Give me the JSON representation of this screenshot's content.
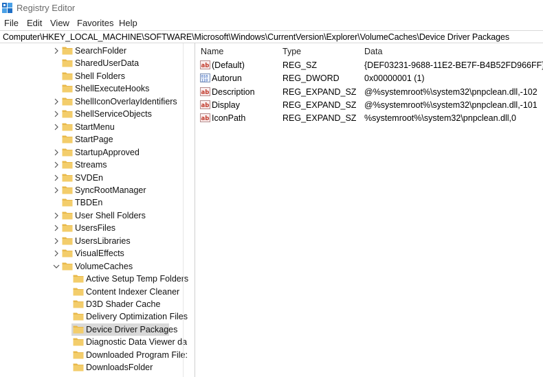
{
  "window": {
    "title": "Registry Editor"
  },
  "menu": [
    "File",
    "Edit",
    "View",
    "Favorites",
    "Help"
  ],
  "address": "Computer\\HKEY_LOCAL_MACHINE\\SOFTWARE\\Microsoft\\Windows\\CurrentVersion\\Explorer\\VolumeCaches\\Device Driver Packages",
  "tree": [
    {
      "label": "SearchFolder",
      "expandable": true,
      "level": 1
    },
    {
      "label": "SharedUserData",
      "expandable": false,
      "level": 1
    },
    {
      "label": "Shell Folders",
      "expandable": false,
      "level": 1
    },
    {
      "label": "ShellExecuteHooks",
      "expandable": false,
      "level": 1
    },
    {
      "label": "ShellIconOverlayIdentifiers",
      "expandable": true,
      "level": 1
    },
    {
      "label": "ShellServiceObjects",
      "expandable": true,
      "level": 1
    },
    {
      "label": "StartMenu",
      "expandable": true,
      "level": 1
    },
    {
      "label": "StartPage",
      "expandable": false,
      "level": 1
    },
    {
      "label": "StartupApproved",
      "expandable": true,
      "level": 1
    },
    {
      "label": "Streams",
      "expandable": true,
      "level": 1
    },
    {
      "label": "SVDEn",
      "expandable": true,
      "level": 1
    },
    {
      "label": "SyncRootManager",
      "expandable": true,
      "level": 1
    },
    {
      "label": "TBDEn",
      "expandable": false,
      "level": 1
    },
    {
      "label": "User Shell Folders",
      "expandable": true,
      "level": 1
    },
    {
      "label": "UsersFiles",
      "expandable": true,
      "level": 1
    },
    {
      "label": "UsersLibraries",
      "expandable": true,
      "level": 1
    },
    {
      "label": "VisualEffects",
      "expandable": true,
      "level": 1
    },
    {
      "label": "VolumeCaches",
      "expandable": true,
      "expanded": true,
      "level": 1
    },
    {
      "label": "Active Setup Temp Folders",
      "expandable": false,
      "level": 2
    },
    {
      "label": "Content Indexer Cleaner",
      "expandable": false,
      "level": 2
    },
    {
      "label": "D3D Shader Cache",
      "expandable": false,
      "level": 2
    },
    {
      "label": "Delivery Optimization Files",
      "expandable": false,
      "level": 2
    },
    {
      "label": "Device Driver Packages",
      "expandable": false,
      "level": 2,
      "selected": true
    },
    {
      "label": "Diagnostic Data Viewer da",
      "expandable": false,
      "level": 2
    },
    {
      "label": "Downloaded Program File:",
      "expandable": false,
      "level": 2
    },
    {
      "label": "DownloadsFolder",
      "expandable": false,
      "level": 2
    }
  ],
  "columns": {
    "name": "Name",
    "type": "Type",
    "data": "Data"
  },
  "values": [
    {
      "name": "(Default)",
      "type": "REG_SZ",
      "data": "{DEF03231-9688-11E2-BE7F-B4B52FD966FF}",
      "icon": "string-value-icon"
    },
    {
      "name": "Autorun",
      "type": "REG_DWORD",
      "data": "0x00000001 (1)",
      "icon": "binary-value-icon"
    },
    {
      "name": "Description",
      "type": "REG_EXPAND_SZ",
      "data": "@%systemroot%\\system32\\pnpclean.dll,-102",
      "icon": "string-value-icon"
    },
    {
      "name": "Display",
      "type": "REG_EXPAND_SZ",
      "data": "@%systemroot%\\system32\\pnpclean.dll,-101",
      "icon": "string-value-icon"
    },
    {
      "name": "IconPath",
      "type": "REG_EXPAND_SZ",
      "data": "%systemroot%\\system32\\pnpclean.dll,0",
      "icon": "string-value-icon"
    }
  ],
  "colors": {
    "folder": "#e8b84a",
    "folder_tab": "#f3cd6b",
    "selected": "#d9d9d9",
    "string_icon_red": "#c0392b",
    "dword_icon_blue": "#2a5ab8"
  }
}
